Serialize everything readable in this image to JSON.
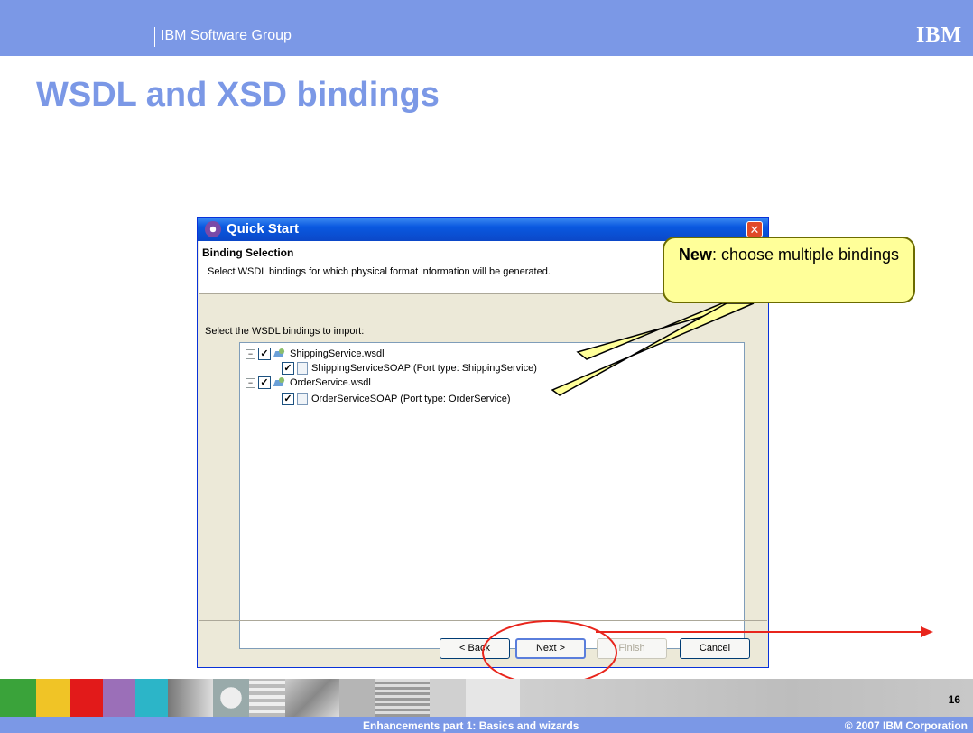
{
  "header": {
    "group": "IBM Software Group",
    "logo": "IBM"
  },
  "slide": {
    "title": "WSDL and XSD bindings"
  },
  "dialog": {
    "title": "Quick Start",
    "banner_title": "Binding Selection",
    "banner_desc": "Select WSDL bindings for which physical format information will be generated.",
    "tree_label": "Select the WSDL bindings to import:",
    "tree": [
      {
        "label": "ShippingService.wsdl",
        "level": 0,
        "checked": true,
        "expander": "−"
      },
      {
        "label": "ShippingServiceSOAP (Port type: ShippingService)",
        "level": 1,
        "checked": true
      },
      {
        "label": "OrderService.wsdl",
        "level": 0,
        "checked": true,
        "expander": "−"
      },
      {
        "label": "OrderServiceSOAP (Port type: OrderService)",
        "level": 1,
        "checked": true
      }
    ],
    "buttons": {
      "back": "< Back",
      "next": "Next >",
      "finish": "Finish",
      "cancel": "Cancel"
    },
    "close_glyph": "✕",
    "check_glyph": "✓"
  },
  "callout": {
    "bold": "New",
    "text": ": choose multiple bindings"
  },
  "footer": {
    "page": "16",
    "center": "Enhancements part 1:  Basics and wizards",
    "copyright": "© 2007 IBM Corporation"
  },
  "colors": {
    "brand_band": "#7b98e6",
    "callout_fill": "#ffff99",
    "highlight_red": "#e8251c"
  }
}
